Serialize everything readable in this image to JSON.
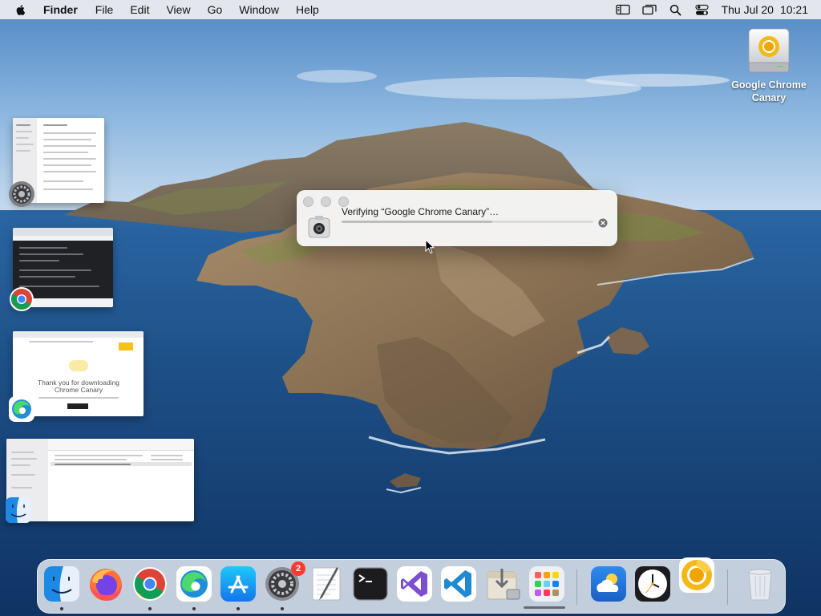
{
  "menubar": {
    "apple_icon": "apple-logo-icon",
    "app_name": "Finder",
    "items": [
      "File",
      "Edit",
      "View",
      "Go",
      "Window",
      "Help"
    ],
    "status_icons": [
      "sidebar-icon",
      "screen-mirroring-icon",
      "spotlight-search-icon",
      "control-center-icon"
    ],
    "clock": {
      "day_date": "Thu Jul 20",
      "time": "10:21"
    }
  },
  "desktop": {
    "icon_label": "Google Chrome Canary",
    "icon": "disk-image-drive-icon"
  },
  "stage_manager": {
    "groups": [
      {
        "app": "System Settings",
        "icon": "system-settings-gear-icon"
      },
      {
        "app": "Google Chrome",
        "icon": "chrome-icon"
      },
      {
        "app": "Microsoft Edge",
        "icon": "edge-icon",
        "page_text": "Thank you for downloading Chrome Canary"
      },
      {
        "app": "Finder",
        "icon": "finder-icon"
      }
    ]
  },
  "dialog": {
    "title": "Verifying “Google Chrome Canary”…",
    "progress": 0.6,
    "cancel_icon": "cancel-x-icon",
    "app_icon": "disk-image-icon"
  },
  "dock": {
    "items": [
      {
        "name": "Finder",
        "icon": "finder-icon",
        "running": true
      },
      {
        "name": "Firefox",
        "icon": "firefox-icon",
        "running": false
      },
      {
        "name": "Google Chrome",
        "icon": "chrome-icon",
        "running": true
      },
      {
        "name": "Microsoft Edge",
        "icon": "edge-icon",
        "running": true
      },
      {
        "name": "App Store",
        "icon": "app-store-icon",
        "running": true
      },
      {
        "name": "System Settings",
        "icon": "system-settings-gear-icon",
        "running": true,
        "badge": "2"
      },
      {
        "name": "TextEdit",
        "icon": "textedit-icon",
        "running": false
      },
      {
        "name": "Terminal",
        "icon": "terminal-icon",
        "running": false
      },
      {
        "name": "Visual Studio",
        "icon": "visual-studio-icon",
        "running": false
      },
      {
        "name": "Visual Studio Code",
        "icon": "vscode-icon",
        "running": false
      },
      {
        "name": "Installer",
        "icon": "installer-icon",
        "running": false
      },
      {
        "name": "Launchpad",
        "icon": "launchpad-icon",
        "running": false
      },
      {
        "name": "Weather",
        "icon": "weather-icon",
        "running": false
      },
      {
        "name": "Clock",
        "icon": "clock-icon",
        "running": false
      },
      {
        "name": "Google Chrome Canary",
        "icon": "chrome-canary-icon",
        "running": false
      },
      {
        "name": "Trash",
        "icon": "trash-icon",
        "running": false
      }
    ]
  },
  "colors": {
    "sea": "#1d4f86",
    "sky": "#8fb9e0",
    "canary": "#f5b819",
    "badge": "#ff3b30",
    "dock_bg": "#ecf0f6"
  }
}
